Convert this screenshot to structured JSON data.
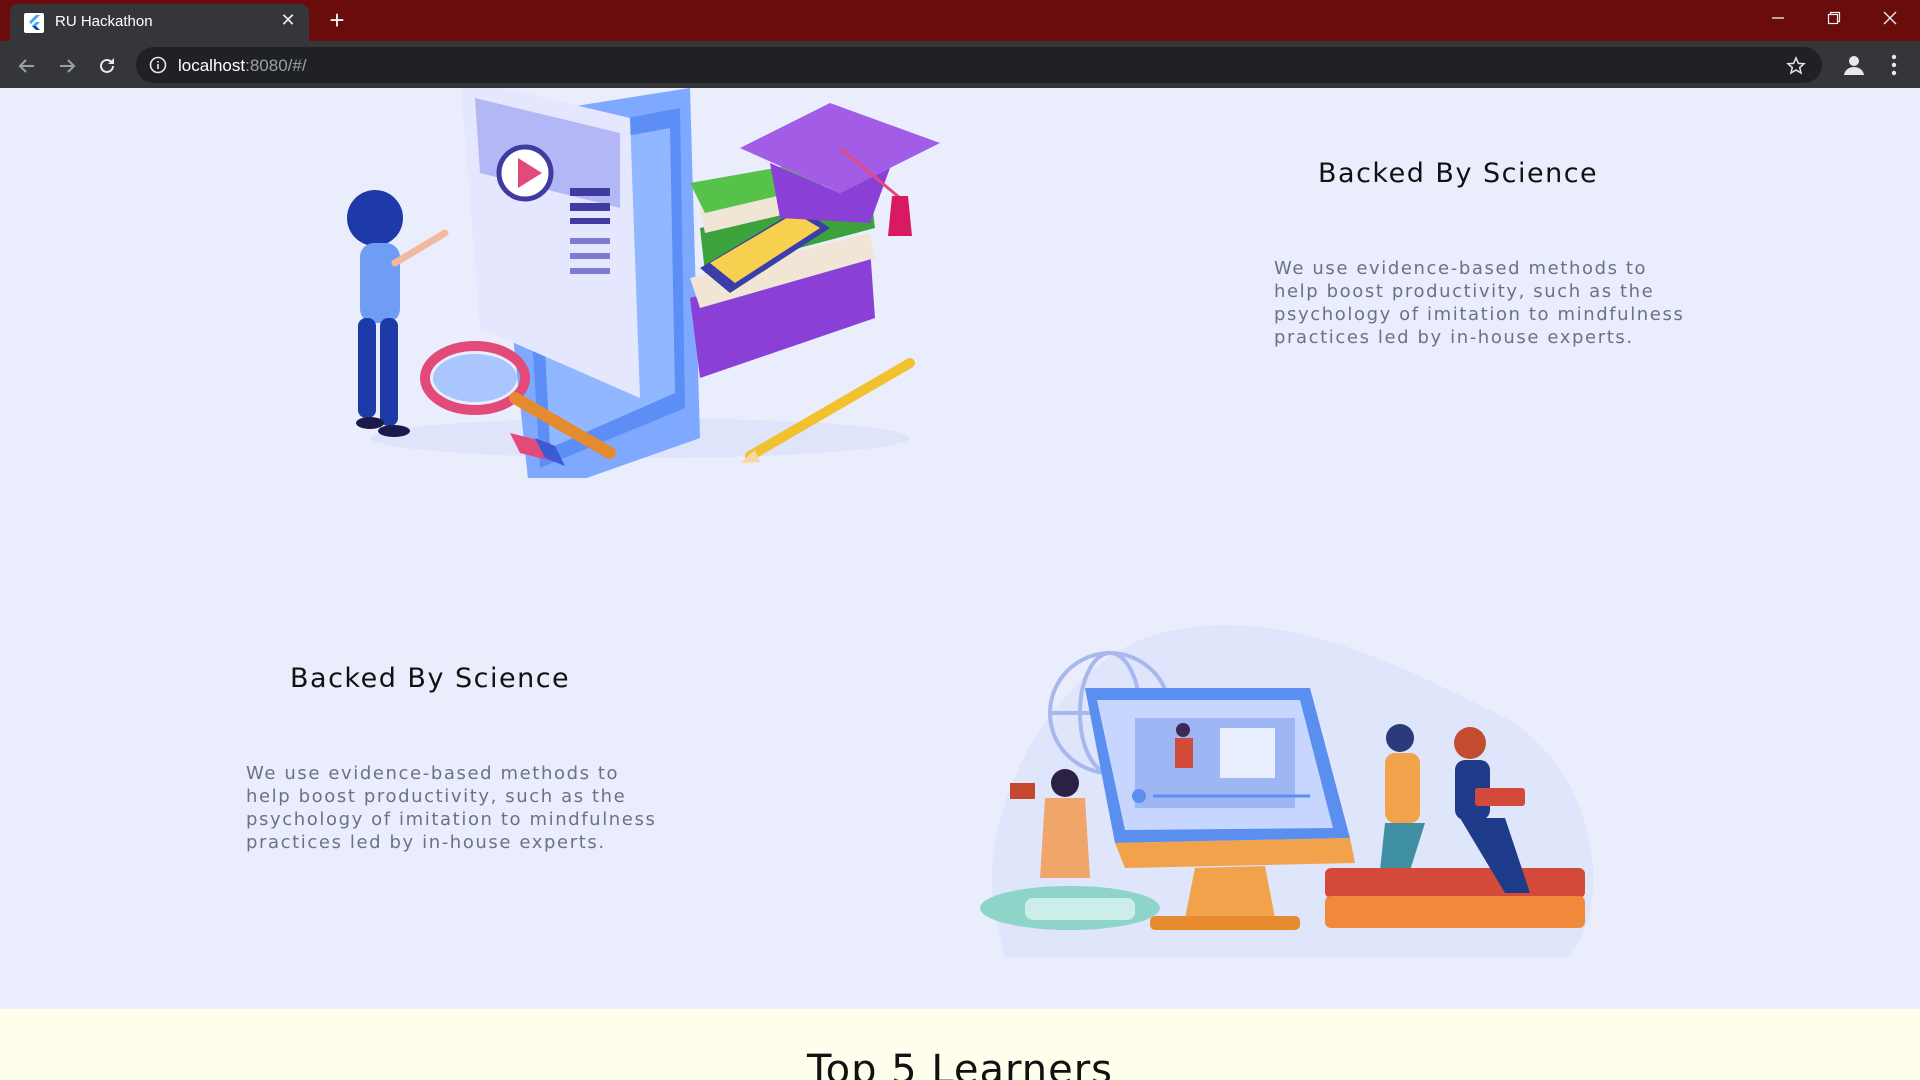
{
  "browser": {
    "tab_title": "RU Hackathon",
    "tab_close_glyph": "✕",
    "new_tab_glyph": "+",
    "url_host": "localhost",
    "url_rest": ":8080/#/",
    "icons": [
      "flutter-favicon-icon",
      "back-icon",
      "forward-icon",
      "reload-icon",
      "info-icon",
      "star-icon",
      "profile-icon",
      "menu-icon",
      "minimize-icon",
      "restore-icon",
      "close-window-icon"
    ],
    "titlebar_color": "#6b0c0c",
    "toolbar_color": "#35363a"
  },
  "features": [
    {
      "title": "Backed By Science",
      "description": "We use evidence-based methods to help boost productivity, such as the psychology of imitation to mindfulness practices led by in-house experts."
    },
    {
      "title": "Backed By Science",
      "description": "We use evidence-based methods to help boost productivity, such as the psychology of imitation to mindfulness practices led by in-house experts."
    }
  ],
  "learners": {
    "title": "Top 5 Learners"
  },
  "colors": {
    "page_bg": "#eaeefc",
    "learners_bg": "#fffdeb"
  }
}
